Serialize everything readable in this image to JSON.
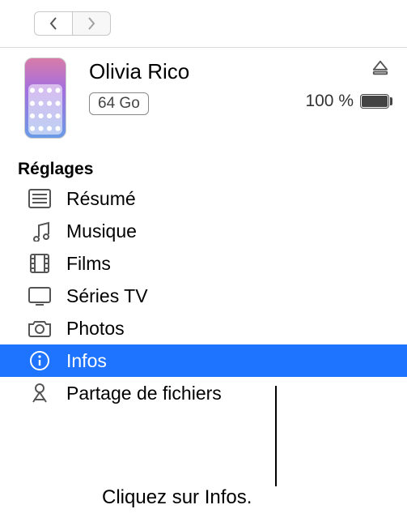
{
  "device": {
    "name": "Olivia Rico",
    "capacity": "64 Go",
    "battery_text": "100 %"
  },
  "sections": {
    "settings_title": "Réglages"
  },
  "items": {
    "summary": {
      "label": "Résumé"
    },
    "music": {
      "label": "Musique"
    },
    "movies": {
      "label": "Films"
    },
    "tv": {
      "label": "Séries TV"
    },
    "photos": {
      "label": "Photos"
    },
    "info": {
      "label": "Infos"
    },
    "files": {
      "label": "Partage de fichiers"
    }
  },
  "callout": "Cliquez sur Infos."
}
